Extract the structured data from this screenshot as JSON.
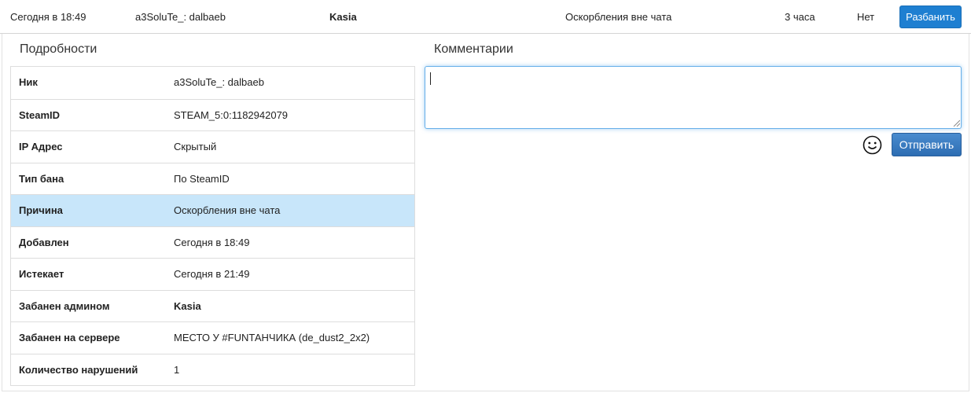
{
  "ban_row": {
    "date": "Сегодня в 18:49",
    "nickname": "a3SoluTe_: dalbaeb",
    "admin": "Kasia",
    "reason": "Оскорбления вне чата",
    "duration": "3 часа",
    "status": "Нет",
    "unban_label": "Разбанить"
  },
  "details": {
    "title": "Подробности",
    "rows": [
      {
        "label": "Ник",
        "value": "a3SoluTe_: dalbaeb"
      },
      {
        "label": "SteamID",
        "value": "STEAM_5:0:1182942079"
      },
      {
        "label": "IP Адрес",
        "value": "Скрытый"
      },
      {
        "label": "Тип бана",
        "value": "По SteamID"
      },
      {
        "label": "Причина",
        "value": "Оскорбления вне чата"
      },
      {
        "label": "Добавлен",
        "value": "Сегодня в 18:49"
      },
      {
        "label": "Истекает",
        "value": "Сегодня в 21:49"
      },
      {
        "label": "Забанен админом",
        "value": "Kasia"
      },
      {
        "label": "Забанен на сервере",
        "value": "МЕСТО У #FUNТАНЧИКА (de_dust2_2x2)"
      },
      {
        "label": "Количество нарушений",
        "value": "1"
      }
    ]
  },
  "comments": {
    "title": "Комментарии",
    "input_value": "",
    "smiley_icon": "smiley-icon",
    "send_label": "Отправить"
  },
  "colors": {
    "highlight_row": "#c8e6fa",
    "primary_button": "#1e7fd1",
    "send_button": "#2d6db3",
    "focus_border": "#66afe9"
  }
}
